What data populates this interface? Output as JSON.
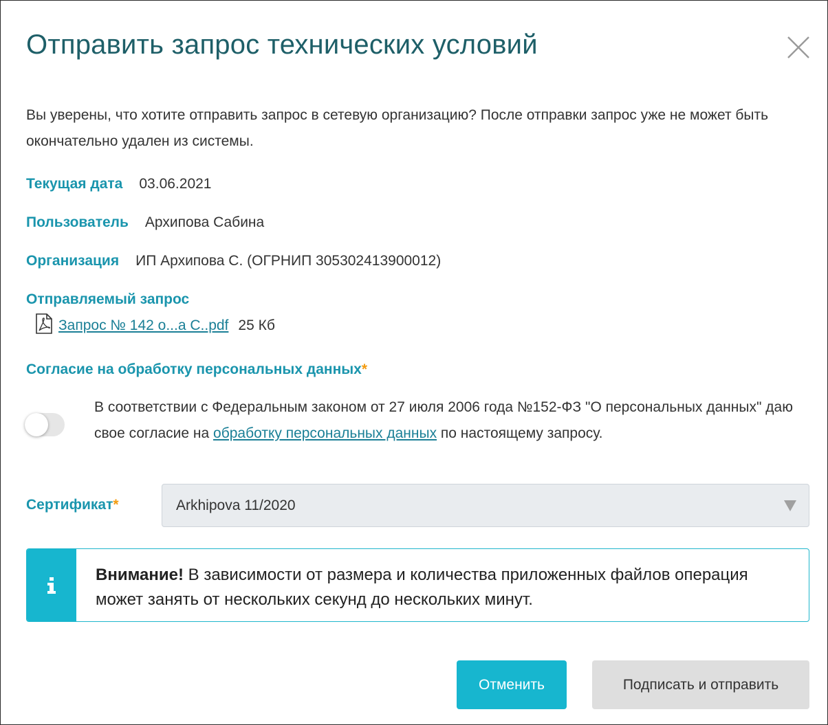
{
  "dialog": {
    "title": "Отправить запрос технических условий",
    "intro": "Вы уверены, что хотите отправить запрос в сетевую организацию? После отправки запрос уже не может быть окончательно удален из системы.",
    "close_icon": "close-icon"
  },
  "fields": {
    "date_label": "Текущая дата",
    "date_value": "03.06.2021",
    "user_label": "Пользователь",
    "user_value": "Архипова Сабина",
    "org_label": "Организация",
    "org_value": "ИП Архипова С. (ОГРНИП 305302413900012)",
    "request_label": "Отправляемый запрос"
  },
  "file": {
    "icon": "pdf-file-icon",
    "name": "Запрос № 142 о...а С..pdf",
    "size": "25 Кб"
  },
  "consent": {
    "label": "Согласие на обработку персональных данных",
    "required_mark": "*",
    "toggle_on": false,
    "text_before": "В соответствии с Федеральным законом от 27 июля 2006 года №152-ФЗ \"О персональных данных\" даю свое согласие на ",
    "link_text": "обработку персональных данных",
    "text_after": " по настоящему запросу."
  },
  "certificate": {
    "label": "Сертификат",
    "required_mark": "*",
    "selected": "Arkhipova 11/2020"
  },
  "alert": {
    "icon": "info-icon",
    "bold": "Внимание!",
    "text": " В зависимости от размера и количества приложенных файлов операция может занять от нескольких секунд до нескольких минут."
  },
  "buttons": {
    "cancel": "Отменить",
    "submit": "Подписать и отправить"
  },
  "colors": {
    "title": "#1e5f68",
    "label": "#1a95ad",
    "accent": "#17b6cf",
    "required": "#f39c12",
    "disabled_button": "#dedede"
  }
}
